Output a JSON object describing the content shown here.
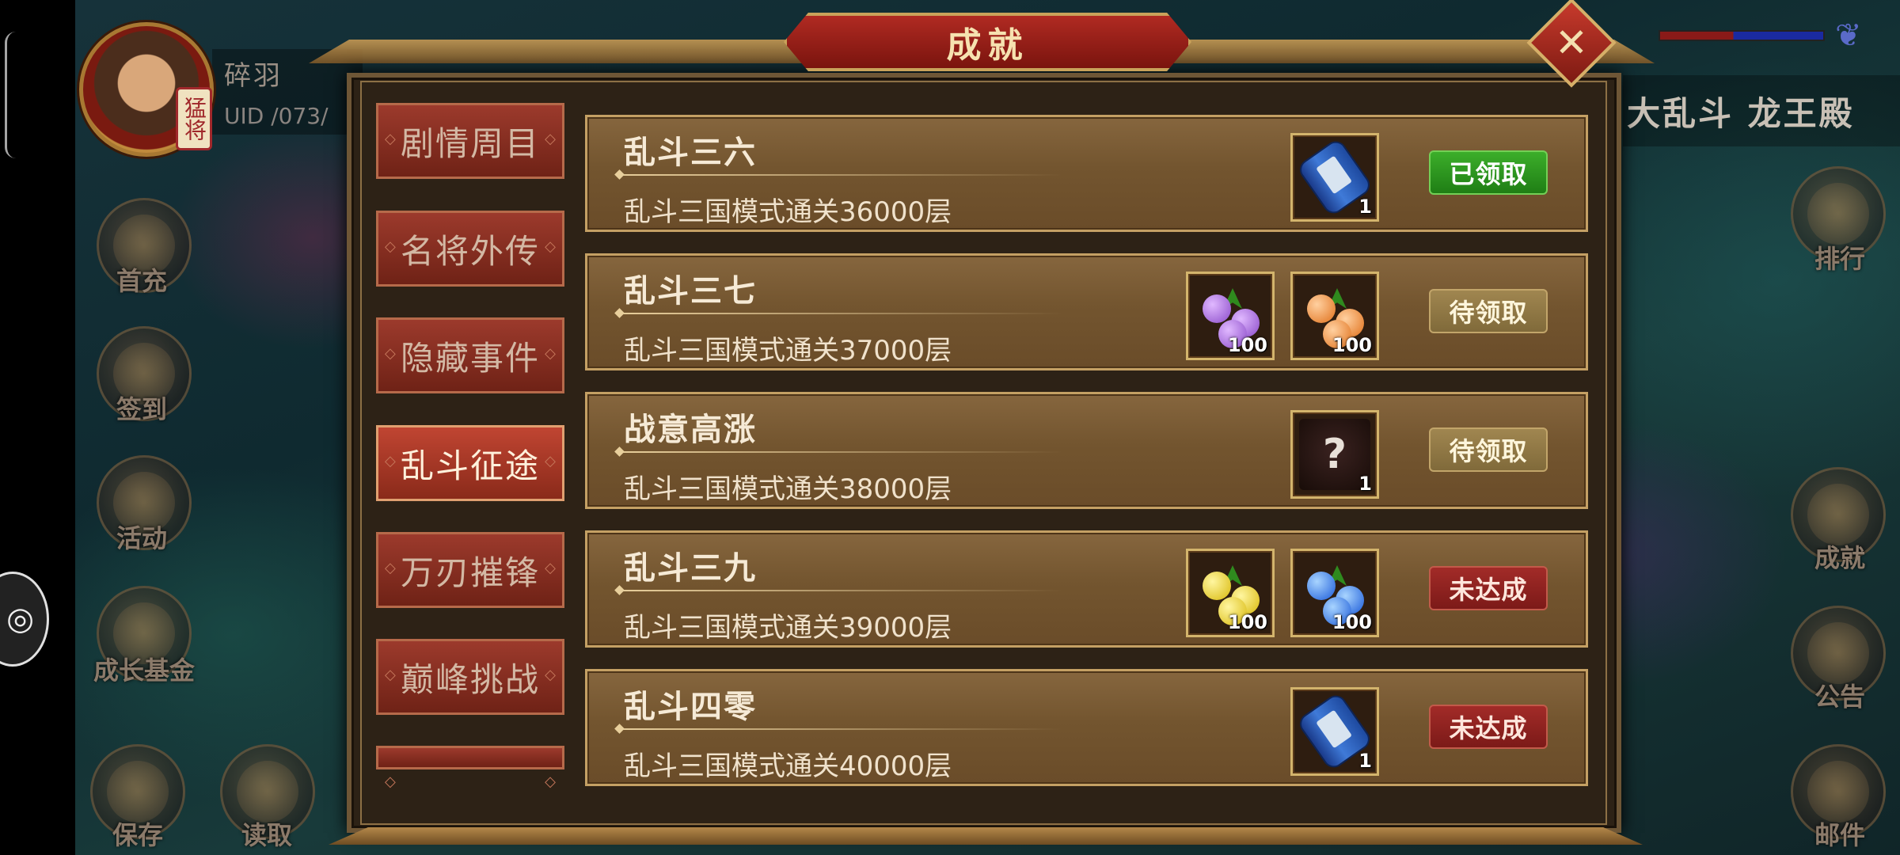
{
  "dialog": {
    "title": "成就",
    "close_icon": "close-icon"
  },
  "player": {
    "name": "碎羽",
    "uid": "UID  /073/",
    "avatar_tag": "猛将"
  },
  "top_right": {
    "title": "大乱斗 龙王殿"
  },
  "left_menu": [
    {
      "label": "首充",
      "icon": "gift-icon"
    },
    {
      "label": "签到",
      "icon": "checkin-icon"
    },
    {
      "label": "活动",
      "icon": "activity-icon"
    },
    {
      "label": "成长基金",
      "icon": "fund-icon"
    },
    {
      "label": "保存",
      "icon": "save-icon"
    },
    {
      "label": "读取",
      "icon": "load-icon"
    }
  ],
  "right_menu": [
    {
      "label": "排行",
      "icon": "ranking-icon"
    },
    {
      "label": "成就",
      "icon": "achievement-icon"
    },
    {
      "label": "公告",
      "icon": "notice-icon"
    },
    {
      "label": "邮件",
      "icon": "mail-icon"
    }
  ],
  "tabs": [
    {
      "label": "剧情周目",
      "active": false
    },
    {
      "label": "名将外传",
      "active": false
    },
    {
      "label": "隐藏事件",
      "active": false
    },
    {
      "label": "乱斗征途",
      "active": true
    },
    {
      "label": "万刃摧锋",
      "active": false
    },
    {
      "label": "巅峰挑战",
      "active": false
    }
  ],
  "achievements": [
    {
      "title": "乱斗三六",
      "desc": "乱斗三国模式通关36000层",
      "status": "已领取",
      "status_type": "claimed",
      "rewards": [
        {
          "icon": "blue-scroll-icon",
          "count": "1"
        }
      ]
    },
    {
      "title": "乱斗三七",
      "desc": "乱斗三国模式通关37000层",
      "status": "待领取",
      "status_type": "pending",
      "rewards": [
        {
          "icon": "purple-fruit-icon",
          "count": "100",
          "color": "#a56ad8"
        },
        {
          "icon": "orange-fruit-icon",
          "count": "100",
          "color": "#f08a2a"
        }
      ]
    },
    {
      "title": "战意高涨",
      "desc": "乱斗三国模式通关38000层",
      "status": "待领取",
      "status_type": "pending",
      "rewards": [
        {
          "icon": "mystery-item-icon",
          "count": "1",
          "glyph": "?"
        }
      ]
    },
    {
      "title": "乱斗三九",
      "desc": "乱斗三国模式通关39000层",
      "status": "未达成",
      "status_type": "locked",
      "rewards": [
        {
          "icon": "yellow-fruit-icon",
          "count": "100",
          "color": "#f0d51a"
        },
        {
          "icon": "blue-fruit-icon",
          "count": "100",
          "color": "#2a7af0"
        }
      ]
    },
    {
      "title": "乱斗四零",
      "desc": "乱斗三国模式通关40000层",
      "status": "未达成",
      "status_type": "locked",
      "rewards": [
        {
          "icon": "blue-scroll-icon",
          "count": "1"
        }
      ]
    }
  ],
  "colors": {
    "claimed": "#2e9a20",
    "pending": "#927a48",
    "locked": "#951f1d",
    "tab_active": "#c04532"
  }
}
